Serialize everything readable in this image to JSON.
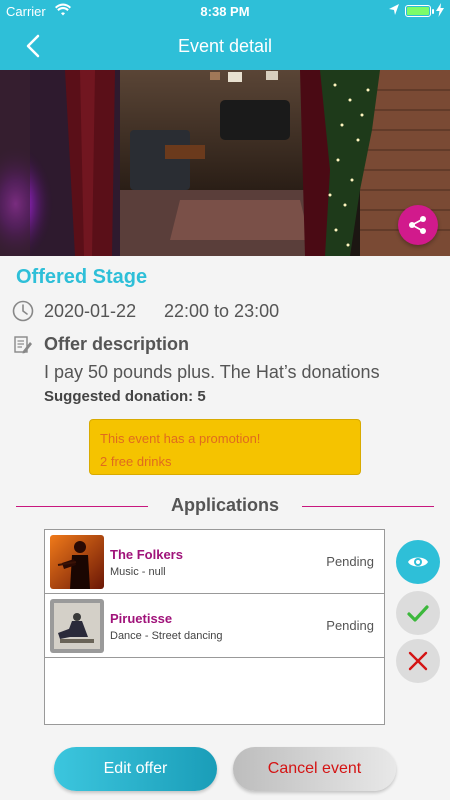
{
  "status_bar": {
    "carrier": "Carrier",
    "time": "8:38 PM",
    "battery_level": 1.0,
    "icons": [
      "wifi-icon",
      "location-icon",
      "battery-icon",
      "bolt-icon"
    ]
  },
  "nav": {
    "title": "Event detail",
    "back_icon": "chevron-left-icon"
  },
  "hero": {
    "share_icon": "share-icon"
  },
  "event": {
    "title": "Offered Stage",
    "date": "2020-01-22",
    "time_range": "22:00 to 23:00",
    "description_heading": "Offer description",
    "description": "I pay 50 pounds plus. The Hat’s donations",
    "suggested_donation": "Suggested donation: 5"
  },
  "promotion": {
    "line1": "This event has a promotion!",
    "line2": "2 free drinks"
  },
  "applications": {
    "heading": "Applications",
    "items": [
      {
        "name": "The Folkers",
        "genre": "Music - null",
        "status": "Pending"
      },
      {
        "name": "Piruetisse",
        "genre": "Dance - Street dancing",
        "status": "Pending"
      }
    ]
  },
  "side_actions": {
    "view_icon": "eye-icon",
    "accept_icon": "check-icon",
    "reject_icon": "close-icon"
  },
  "buttons": {
    "edit": "Edit offer",
    "cancel": "Cancel event"
  },
  "colors": {
    "primary": "#2ebfd8",
    "accent_pink": "#d11a8c",
    "name_purple": "#a0137a",
    "promo_bg": "#f5c300",
    "promo_text": "#e06b1e",
    "cancel_text": "#d41414",
    "accept_green": "#3cb83c"
  }
}
